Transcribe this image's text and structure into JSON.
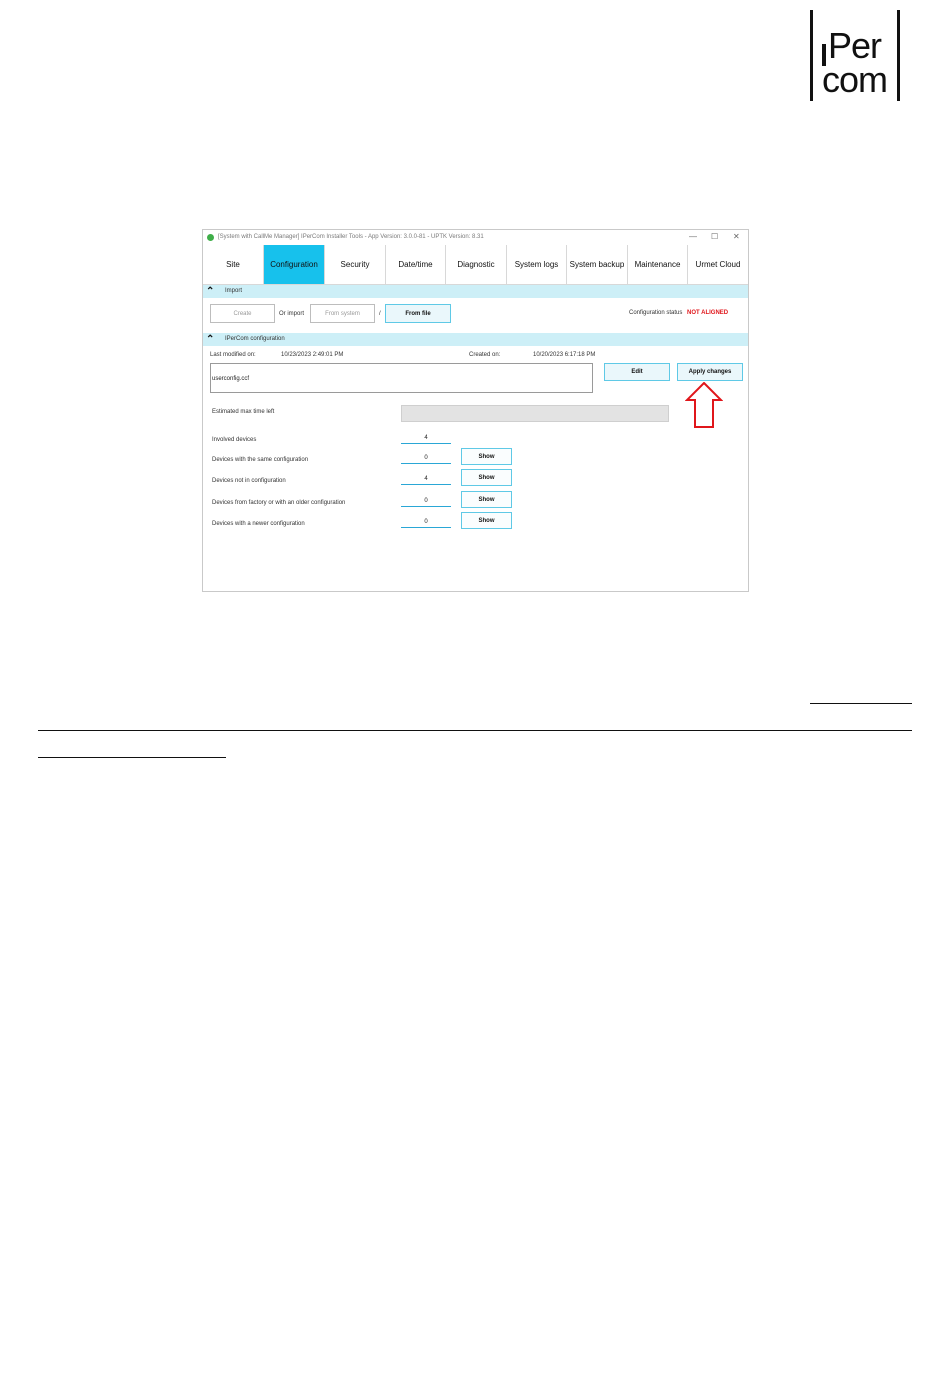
{
  "logo": {
    "text_top": "Per",
    "text_bottom": "com"
  },
  "window": {
    "title": "[System with CallMe Manager] IPerCom Installer Tools - App Version: 3.0.0-81 - UPTK Version: 8.31",
    "controls": {
      "minimize": "—",
      "maximize": "☐",
      "close": "✕"
    }
  },
  "tabs": [
    {
      "label": "Site"
    },
    {
      "label": "Configuration",
      "active": true
    },
    {
      "label": "Security"
    },
    {
      "label": "Date/time"
    },
    {
      "label": "Diagnostic"
    },
    {
      "label": "System logs"
    },
    {
      "label": "System backup"
    },
    {
      "label": "Maintenance"
    },
    {
      "label": "Urmet Cloud"
    }
  ],
  "import_section": {
    "header": "Import",
    "create_button": "Create",
    "or_import": "Or import",
    "from_system_button": "From system",
    "separator": "/",
    "from_file_button": "From file",
    "status_label": "Configuration status",
    "status_value": "NOT ALIGNED"
  },
  "config_section": {
    "header": "IPerCom configuration",
    "last_modified_label": "Last modified on:",
    "last_modified_value": "10/23/2023 2:49:01 PM",
    "created_label": "Created on:",
    "created_value": "10/20/2023 6:17:18 PM",
    "file_name": "userconfig.ccf",
    "edit_button": "Edit",
    "apply_button": "Apply changes",
    "estimated_label": "Estimated max time left",
    "rows": [
      {
        "label": "Involved devices",
        "value": "4"
      },
      {
        "label": "Devices with the same configuration",
        "value": "0",
        "button": "Show"
      },
      {
        "label": "Devices not in configuration",
        "value": "4",
        "button": "Show"
      },
      {
        "label": "Devices from factory or with an older configuration",
        "value": "0",
        "button": "Show"
      },
      {
        "label": "Devices with a newer configuration",
        "value": "0",
        "button": "Show"
      }
    ]
  },
  "icons": {
    "app": "app-icon",
    "collapse": "chevron-up-icon",
    "callout": "red-up-arrow-icon"
  },
  "colors": {
    "active_tab": "#17c1ec",
    "section_header": "#cdeff7",
    "status_red": "#e0161b"
  }
}
